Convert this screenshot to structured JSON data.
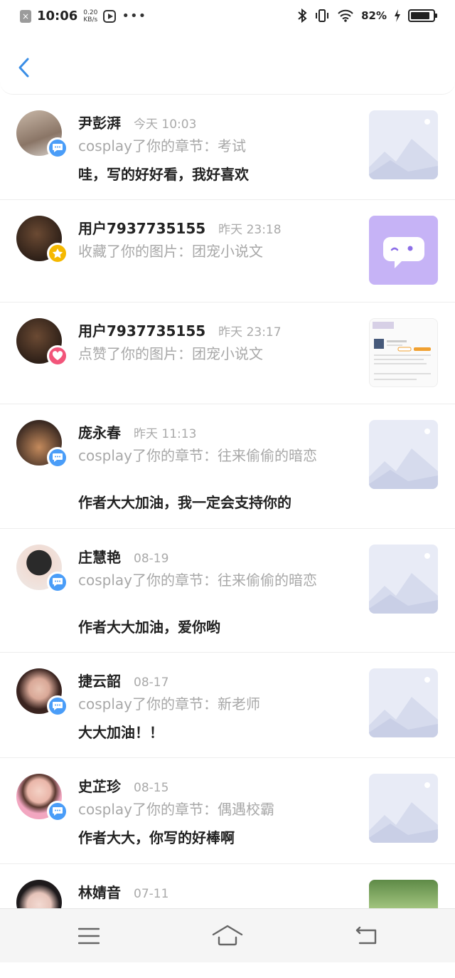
{
  "status": {
    "time": "10:06",
    "speed_top": "0.20",
    "speed_bottom": "KB/s",
    "battery": "82%"
  },
  "header": {
    "back_icon": "chevron-left-icon"
  },
  "notifications": [
    {
      "name": "尹彭湃",
      "time": "今天 10:03",
      "action": "cosplay了你的章节：考试",
      "comment": "哇，写的好好看，我好喜欢",
      "badge": "comment",
      "badge_color": "#4a9df8",
      "thumb": "placeholder"
    },
    {
      "name": "用户7937735155",
      "time": "昨天 23:18",
      "action": "收藏了你的图片：团宠小说文",
      "comment": "",
      "badge": "star",
      "badge_color": "#f5b800",
      "thumb": "chat-bubble"
    },
    {
      "name": "用户7937735155",
      "time": "昨天 23:17",
      "action": "点赞了你的图片：团宠小说文",
      "comment": "",
      "badge": "heart",
      "badge_color": "#f2557a",
      "thumb": "screenshot"
    },
    {
      "name": "庞永春",
      "time": "昨天 11:13",
      "action": "cosplay了你的章节：往来偷偷的暗恋",
      "comment": "作者大大加油，我一定会支持你的",
      "badge": "comment",
      "badge_color": "#4a9df8",
      "thumb": "placeholder"
    },
    {
      "name": "庄慧艳",
      "time": "08-19",
      "action": "cosplay了你的章节：往来偷偷的暗恋",
      "comment": "作者大大加油，爱你哟",
      "badge": "comment",
      "badge_color": "#4a9df8",
      "thumb": "placeholder"
    },
    {
      "name": "捷云韶",
      "time": "08-17",
      "action": "cosplay了你的章节：新老师",
      "comment": "大大加油！！",
      "badge": "comment",
      "badge_color": "#4a9df8",
      "thumb": "placeholder"
    },
    {
      "name": "史芷珍",
      "time": "08-15",
      "action": "cosplay了你的章节：偶遇校霸",
      "comment": "作者大大，你写的好棒啊",
      "badge": "comment",
      "badge_color": "#4a9df8",
      "thumb": "placeholder"
    },
    {
      "name": "林婧音",
      "time": "07-11",
      "action": "",
      "comment": "",
      "badge": "none",
      "badge_color": "#4a9df8",
      "thumb": "photo"
    }
  ],
  "navbar": {
    "menu_icon": "menu-icon",
    "home_icon": "home-icon",
    "back_icon": "back-icon"
  }
}
